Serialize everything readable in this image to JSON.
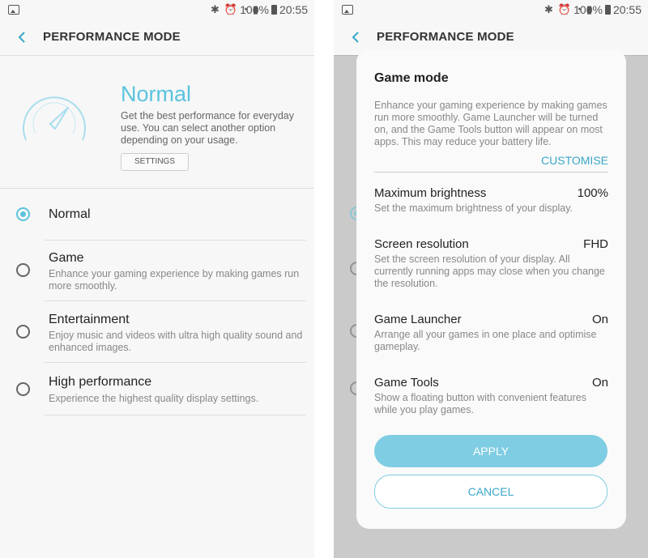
{
  "status": {
    "battery_pct": "100%",
    "time": "20:55"
  },
  "left": {
    "appbar": {
      "title": "PERFORMANCE MODE"
    },
    "hero": {
      "title": "Normal",
      "description": "Get the best performance for everyday use. You can select another option depending on your usage.",
      "settings_label": "SETTINGS"
    },
    "options": [
      {
        "title": "Normal",
        "description": "",
        "selected": true
      },
      {
        "title": "Game",
        "description": "Enhance your gaming experience by making games run more smoothly.",
        "selected": false
      },
      {
        "title": "Entertainment",
        "description": "Enjoy music and videos with ultra high quality sound and enhanced images.",
        "selected": false
      },
      {
        "title": "High performance",
        "description": "Experience the highest quality display settings.",
        "selected": false
      }
    ]
  },
  "right": {
    "appbar": {
      "title": "PERFORMANCE MODE"
    },
    "dialog": {
      "title": "Game mode",
      "description": "Enhance your gaming experience by making games run more smoothly. Game Launcher will be turned on, and the Game Tools button will appear on most apps. This may reduce your battery life.",
      "customise_label": "CUSTOMISE",
      "rows": [
        {
          "title": "Maximum brightness",
          "value": "100%",
          "description": "Set the maximum brightness of your display."
        },
        {
          "title": "Screen resolution",
          "value": "FHD",
          "description": "Set the screen resolution of your display. All currently running apps may close when you change the resolution."
        },
        {
          "title": "Game Launcher",
          "value": "On",
          "description": "Arrange all your games in one place and optimise gameplay."
        },
        {
          "title": "Game Tools",
          "value": "On",
          "description": "Show a floating button with convenient features while you play games."
        }
      ],
      "apply_label": "APPLY",
      "cancel_label": "CANCEL"
    }
  },
  "colors": {
    "accent": "#5bc3de",
    "button": "#7fcde3",
    "scrim": "#bdbdbd"
  },
  "icons": [
    "back-icon",
    "speedometer-icon",
    "bluetooth-icon",
    "alarm-icon",
    "wifi-icon",
    "signal-icon",
    "battery-icon",
    "gallery-icon"
  ]
}
